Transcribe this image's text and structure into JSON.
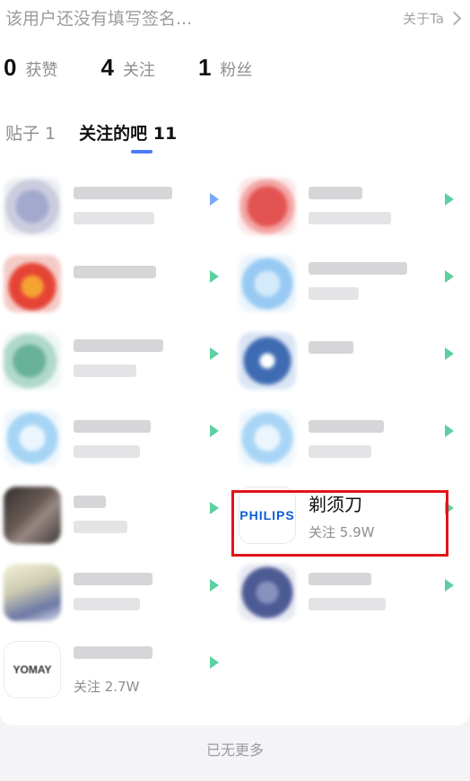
{
  "profile": {
    "signature": "该用户还没有填写签名...",
    "about_label": "关于Ta"
  },
  "stats": [
    {
      "value": "0",
      "label": "获赞"
    },
    {
      "value": "4",
      "label": "关注"
    },
    {
      "value": "1",
      "label": "粉丝"
    }
  ],
  "tabs": [
    {
      "label": "贴子 1",
      "active": false
    },
    {
      "label": "关注的吧 11",
      "active": true
    }
  ],
  "forums": [
    {
      "name": "",
      "follow": "",
      "icon": "blurred-avatar",
      "accent": "#9aa0c8"
    },
    {
      "name": "",
      "follow": "",
      "icon": "blurred-avatar",
      "accent": "#e0413f"
    },
    {
      "name": "",
      "follow": "",
      "icon": "blurred-avatar",
      "accent": "#e33020"
    },
    {
      "name": "",
      "follow": "",
      "icon": "blurred-avatar",
      "accent": "#8cc4f2"
    },
    {
      "name": "",
      "follow": "",
      "icon": "blurred-avatar",
      "accent": "#58a98e"
    },
    {
      "name": "",
      "follow": "",
      "icon": "blurred-avatar",
      "accent": "#2a5caa"
    },
    {
      "name": "",
      "follow": "",
      "icon": "blurred-avatar",
      "accent": "#9cd0f5"
    },
    {
      "name": "",
      "follow": "",
      "icon": "blurred-avatar",
      "accent": "#9fd1f6"
    },
    {
      "name": "",
      "follow": "",
      "icon": "blurred-avatar",
      "accent": "#3c2f2a"
    },
    {
      "name": "剃须刀",
      "follow": "关注 5.9W",
      "icon": "philips-logo",
      "logo_text": "PHILIPS",
      "accent": "#0b5ed7"
    },
    {
      "name": "",
      "follow": "",
      "icon": "blurred-avatar",
      "accent": "#c9c6a8"
    },
    {
      "name": "",
      "follow": "",
      "icon": "blurred-avatar",
      "accent": "#3a4a8a"
    },
    {
      "name": "",
      "follow": "关注 2.7W",
      "icon": "blurred-avatar",
      "logo_text": "YOMAY",
      "accent": "#d83a3a"
    }
  ],
  "footer": {
    "end_text": "已无更多"
  },
  "colors": {
    "enter_arrow": "#5dd0a0",
    "highlight": "#e0141a",
    "active_tab_indicator": "#4d7cff"
  }
}
